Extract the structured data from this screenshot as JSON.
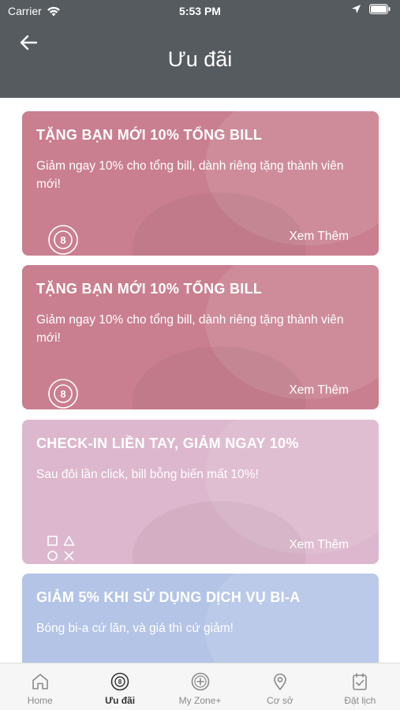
{
  "status_bar": {
    "carrier": "Carrier",
    "time": "5:53 PM"
  },
  "header": {
    "title": "Ưu đãi"
  },
  "promos": [
    {
      "title": "TẶNG BẠN MỚI 10% TỔNG BILL",
      "description": "Giảm ngay 10% cho tổng bill, dành riêng tặng thành viên mới!",
      "more_label": "Xem Thêm",
      "icon": "billiard-8-ball-icon",
      "color": "#c97f90"
    },
    {
      "title": "TẶNG BẠN MỚI 10% TỔNG BILL",
      "description": "Giảm ngay 10% cho tổng bill, dành riêng tặng thành viên mới!",
      "more_label": "Xem Thêm",
      "icon": "billiard-8-ball-icon",
      "color": "#c97f90"
    },
    {
      "title": "CHECK-IN LIỀN TAY, GIẢM NGAY 10%",
      "description": "Sau đôi lần click, bill bỗng biến mất 10%!",
      "more_label": "Xem Thêm",
      "icon": "game-symbols-icon",
      "color": "#ddb7cd"
    },
    {
      "title": "GIẢM 5% KHI SỬ DỤNG DỊCH VỤ BI-A",
      "description": "Bóng bi-a cứ lăn, và giá thì cứ giảm!",
      "color": "#b4c4e6"
    }
  ],
  "tab_bar": {
    "tabs": [
      {
        "label": "Home",
        "icon": "home-icon",
        "active": false
      },
      {
        "label": "Ưu đãi",
        "icon": "billiard-8-ball-icon",
        "active": true
      },
      {
        "label": "My Zone+",
        "icon": "plus-circle-icon",
        "active": false
      },
      {
        "label": "Cơ sở",
        "icon": "location-pin-icon",
        "active": false
      },
      {
        "label": "Đặt lịch",
        "icon": "calendar-check-icon",
        "active": false
      }
    ]
  }
}
